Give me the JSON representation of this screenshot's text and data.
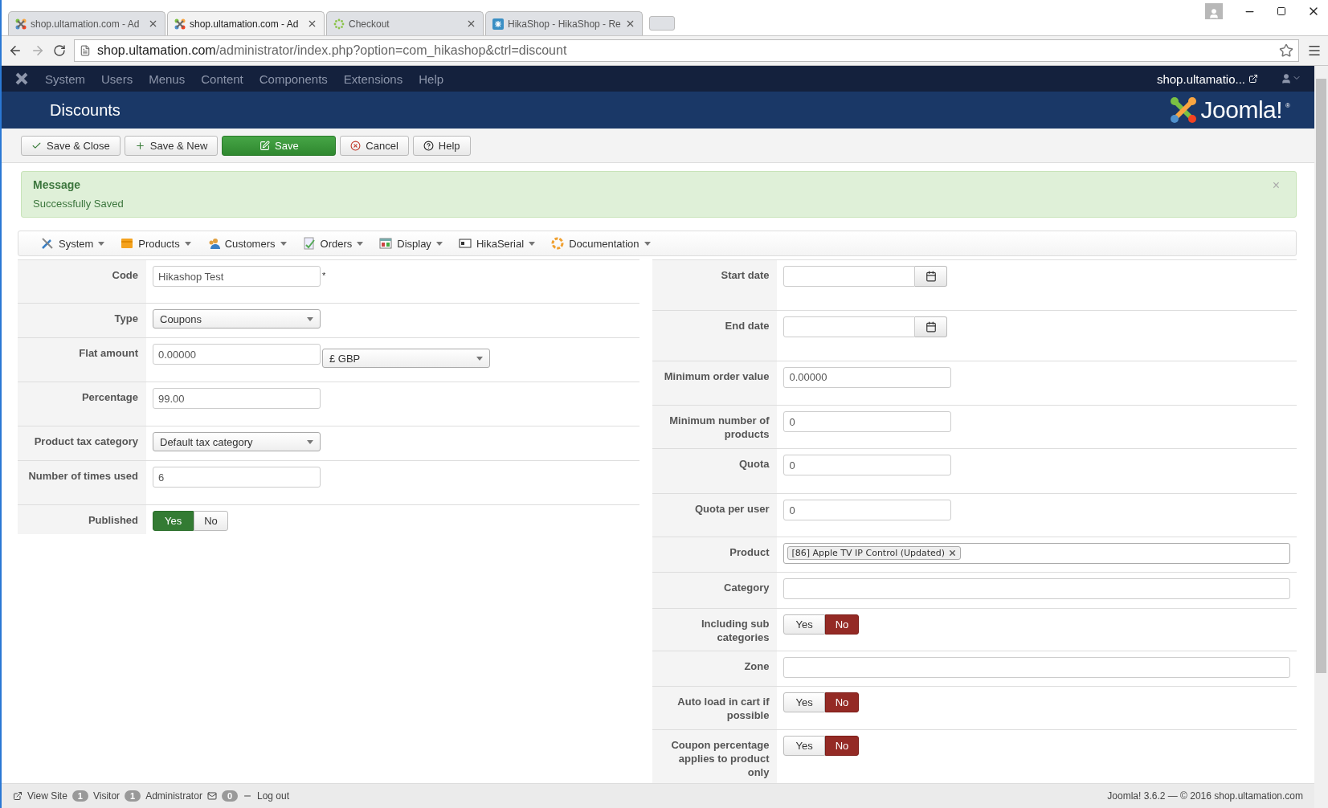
{
  "browser": {
    "tabs": [
      {
        "title": "shop.ultamation.com - Ad",
        "selected": false
      },
      {
        "title": "shop.ultamation.com - Ad",
        "selected": true
      },
      {
        "title": "Checkout",
        "selected": false
      },
      {
        "title": "HikaShop - HikaShop - Re",
        "selected": false
      }
    ],
    "address": {
      "host": "shop.ultamation.com",
      "path": "/administrator/index.php?option=com_hikashop&ctrl=discount"
    }
  },
  "admin_nav": {
    "items": [
      "System",
      "Users",
      "Menus",
      "Content",
      "Components",
      "Extensions",
      "Help"
    ],
    "site_link": "shop.ultamatio..."
  },
  "header": {
    "title": "Discounts",
    "logo_text": "Joomla!",
    "logo_mark": "®"
  },
  "toolbar": [
    {
      "label": "Save & Close",
      "kind": "default"
    },
    {
      "label": "Save & New",
      "kind": "default"
    },
    {
      "label": "Save",
      "kind": "primary"
    },
    {
      "label": "Cancel",
      "kind": "default"
    },
    {
      "label": "Help",
      "kind": "default"
    }
  ],
  "message": {
    "heading": "Message",
    "text": "Successfully Saved",
    "close": "×"
  },
  "submenu": [
    {
      "label": "System"
    },
    {
      "label": "Products"
    },
    {
      "label": "Customers"
    },
    {
      "label": "Orders"
    },
    {
      "label": "Display"
    },
    {
      "label": "HikaSerial"
    },
    {
      "label": "Documentation"
    }
  ],
  "left_fields": [
    {
      "label": "Code",
      "kind": "text",
      "value": "Hikashop Test",
      "required": true,
      "required_mark": "*"
    },
    {
      "label": "Type",
      "kind": "select",
      "value": "Coupons"
    },
    {
      "label": "Flat amount",
      "kind": "amount",
      "value": "0.00000",
      "currency": "£ GBP"
    },
    {
      "label": "Percentage",
      "kind": "text",
      "value": "99.00"
    },
    {
      "label": "Product tax category",
      "kind": "select",
      "value": "Default tax category"
    },
    {
      "label": "Number of times used",
      "kind": "text",
      "value": "6"
    },
    {
      "label": "Published",
      "kind": "toggle",
      "options": [
        {
          "label": "Yes",
          "selected": true
        },
        {
          "label": "No",
          "selected": false
        }
      ]
    }
  ],
  "right_fields": [
    {
      "label": "Start date",
      "kind": "date"
    },
    {
      "label": "End date",
      "kind": "date"
    },
    {
      "label": "Minimum order value",
      "kind": "text",
      "value": "0.00000"
    },
    {
      "label": "Minimum number of products",
      "kind": "text",
      "value": "0"
    },
    {
      "label": "Quota",
      "kind": "text",
      "value": "0"
    },
    {
      "label": "Quota per user",
      "kind": "text",
      "value": "0"
    },
    {
      "label": "Product",
      "kind": "tags",
      "tags": [
        "[86] Apple TV IP Control (Updated)"
      ]
    },
    {
      "label": "Category",
      "kind": "wide"
    },
    {
      "label": "Including sub categories",
      "kind": "toggle",
      "options": [
        {
          "label": "Yes",
          "selected": false
        },
        {
          "label": "No",
          "selected": true
        }
      ]
    },
    {
      "label": "Zone",
      "kind": "wide"
    },
    {
      "label": "Auto load in cart if possible",
      "kind": "toggle",
      "options": [
        {
          "label": "Yes",
          "selected": false
        },
        {
          "label": "No",
          "selected": true
        }
      ]
    },
    {
      "label": "Coupon percentage applies to product only",
      "kind": "toggle",
      "options": [
        {
          "label": "Yes",
          "selected": false
        },
        {
          "label": "No",
          "selected": true
        }
      ]
    }
  ],
  "status_bar": {
    "view_site": "View Site",
    "visitors": "1",
    "visitors_label": "Visitor",
    "admins": "1",
    "admins_label": "Administrator",
    "messages": "0",
    "logout": "Log out",
    "version": "Joomla! 3.6.2 — © 2016 shop.ultamation.com"
  }
}
